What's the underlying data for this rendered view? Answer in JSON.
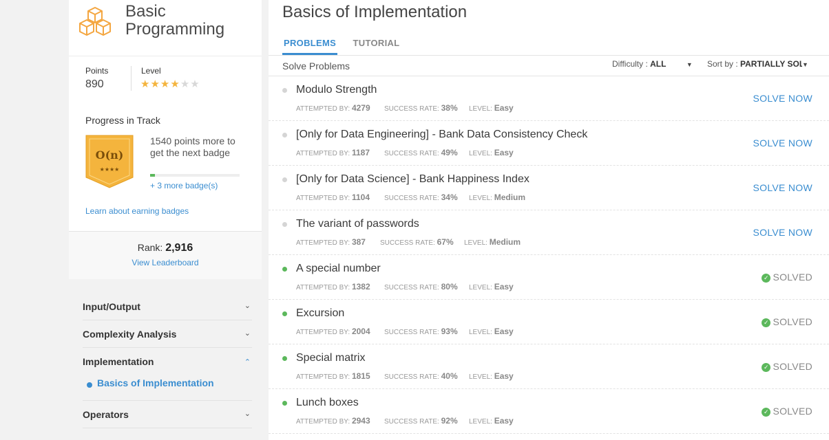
{
  "track": {
    "title_line1": "Basic",
    "title_line2": "Programming",
    "icon": "boxes-icon"
  },
  "stats": {
    "points_label": "Points",
    "points_value": "890",
    "level_label": "Level",
    "level_stars": 4,
    "level_max": 6
  },
  "progress": {
    "title": "Progress in Track",
    "badge_text": "O(n)",
    "badge_stars": "★★★★",
    "points_more": "1540 points more to get the next badge",
    "fraction": 0.05,
    "more_badges": "+ 3 more badge(s)",
    "learn_link": "Learn about earning badges"
  },
  "rank": {
    "label": "Rank:",
    "value": "2,916",
    "leaderboard_link": "View Leaderboard"
  },
  "nav": {
    "items": [
      {
        "label": "Input/Output",
        "chevron": "⌄"
      },
      {
        "label": "Complexity Analysis",
        "chevron": "⌄"
      },
      {
        "label": "Implementation",
        "chevron": "⌃"
      },
      {
        "label": "Operators",
        "chevron": "⌄"
      }
    ],
    "active_sub": "Basics of Implementation"
  },
  "page": {
    "title": "Basics of Implementation",
    "tabs": [
      "PROBLEMS",
      "TUTORIAL"
    ],
    "solve_label": "Solve Problems",
    "difficulty_label": "Difficulty :",
    "difficulty_value": "ALL",
    "sort_label": "Sort by :",
    "sort_value": "PARTIALLY SOL"
  },
  "meta_labels": {
    "attempted": "ATTEMPTED BY:",
    "success": "SUCCESS RATE:",
    "level": "LEVEL:"
  },
  "problems": [
    {
      "title": "Modulo Strength",
      "attempted": "4279",
      "success": "38%",
      "level": "Easy",
      "status": "SOLVE NOW"
    },
    {
      "title": "[Only for Data Engineering] - Bank Data Consistency Check",
      "attempted": "1187",
      "success": "49%",
      "level": "Easy",
      "status": "SOLVE NOW"
    },
    {
      "title": "[Only for Data Science] - Bank Happiness Index",
      "attempted": "1104",
      "success": "34%",
      "level": "Medium",
      "status": "SOLVE NOW"
    },
    {
      "title": "The variant of passwords",
      "attempted": "387",
      "success": "67%",
      "level": "Medium",
      "status": "SOLVE NOW"
    },
    {
      "title": "A special number",
      "attempted": "1382",
      "success": "80%",
      "level": "Easy",
      "status": "SOLVED"
    },
    {
      "title": "Excursion",
      "attempted": "2004",
      "success": "93%",
      "level": "Easy",
      "status": "SOLVED"
    },
    {
      "title": "Special matrix",
      "attempted": "1815",
      "success": "40%",
      "level": "Easy",
      "status": "SOLVED"
    },
    {
      "title": "Lunch boxes",
      "attempted": "2943",
      "success": "92%",
      "level": "Easy",
      "status": "SOLVED"
    }
  ],
  "colors": {
    "accent": "#3a8dd0",
    "solved": "#5cb85c",
    "star": "#f4b43d",
    "badge": "#f4b43d"
  }
}
